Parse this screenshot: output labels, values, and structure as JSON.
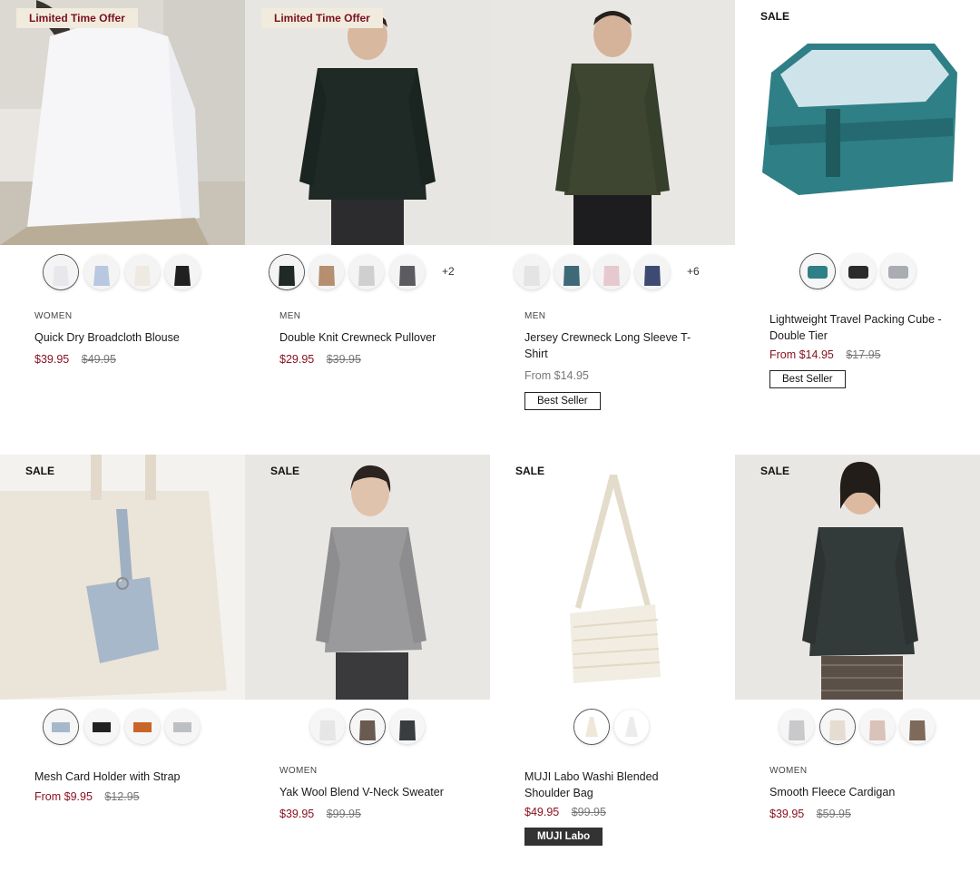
{
  "products": [
    {
      "badge": "Limited Time Offer",
      "category": "WOMEN",
      "name": "Quick Dry Broadcloth Blouse",
      "price": "$39.95",
      "was": "$49.95",
      "swatch_count_extra": "",
      "tag": ""
    },
    {
      "badge": "Limited Time Offer",
      "category": "MEN",
      "name": "Double Knit Crewneck Pullover",
      "price": "$29.95",
      "was": "$39.95",
      "swatch_count_extra": "+2",
      "tag": ""
    },
    {
      "badge": "",
      "category": "MEN",
      "name": "Jersey Crewneck Long Sleeve T-Shirt",
      "price_from": "From $14.95",
      "swatch_count_extra": "+6",
      "tag": "Best Seller"
    },
    {
      "badge": "SALE",
      "category": "",
      "name": "Lightweight Travel Packing Cube - Double Tier",
      "price": "From $14.95",
      "was": "$17.95",
      "swatch_count_extra": "",
      "tag": "Best Seller"
    },
    {
      "badge": "SALE",
      "category": "",
      "name": "Mesh Card Holder with Strap",
      "price": "From $9.95",
      "was": "$12.95",
      "swatch_count_extra": "",
      "tag": ""
    },
    {
      "badge": "SALE",
      "category": "WOMEN",
      "name": "Yak Wool Blend V-Neck Sweater",
      "price": "$39.95",
      "was": "$99.95",
      "swatch_count_extra": "",
      "tag": ""
    },
    {
      "badge": "SALE",
      "category": "",
      "name": "MUJI Labo Washi Blended Shoulder Bag",
      "price": "$49.95",
      "was": "$99.95",
      "swatch_count_extra": "",
      "tag": "MUJI Labo"
    },
    {
      "badge": "SALE",
      "category": "WOMEN",
      "name": "Smooth Fleece Cardigan",
      "price": "$39.95",
      "was": "$59.95",
      "swatch_count_extra": "",
      "tag": ""
    }
  ],
  "colors": {
    "price_sale": "#8a1020",
    "offer_badge_bg": "#f1ebdd",
    "offer_badge_text": "#7a1020"
  }
}
